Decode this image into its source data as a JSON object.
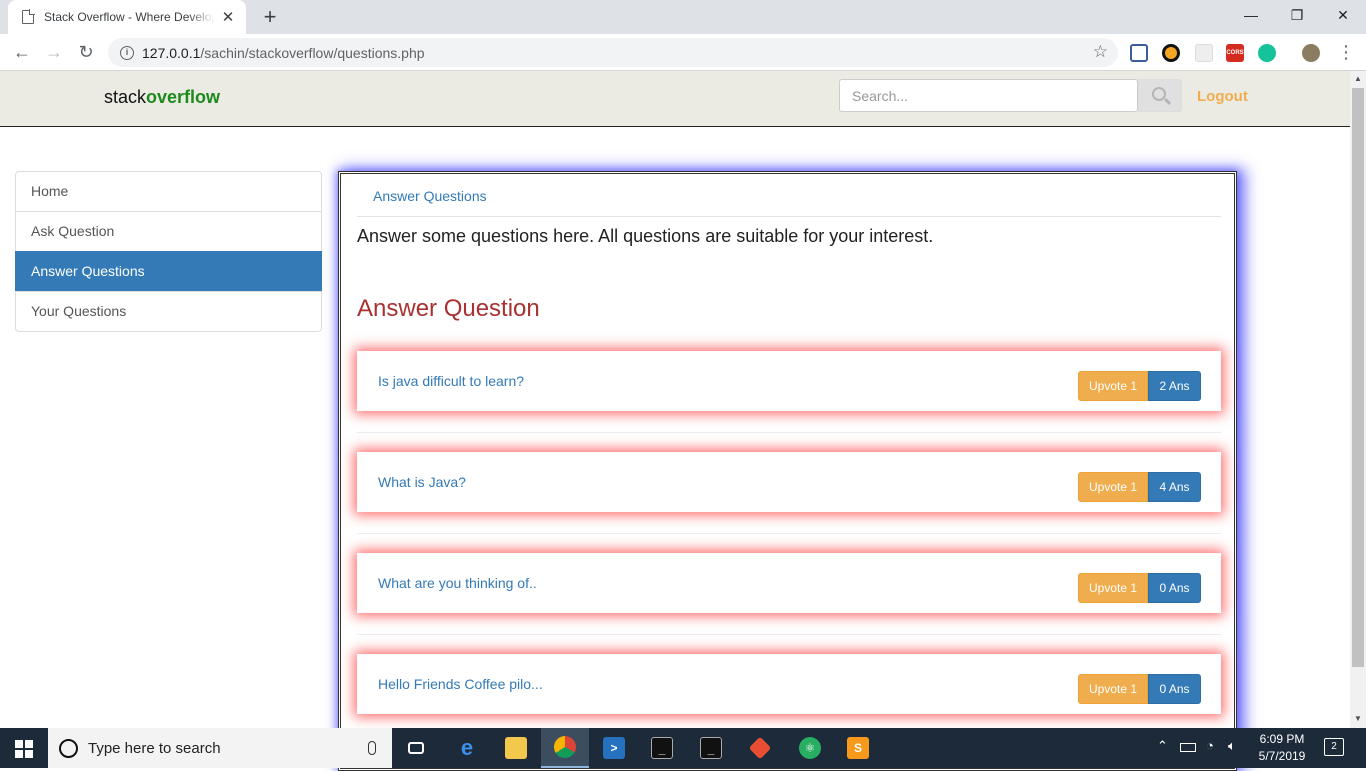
{
  "browser": {
    "tab_title": "Stack Overflow - Where Developers",
    "tab_close": "✕",
    "new_tab": "+",
    "url_host": "127.0.0.1",
    "url_path": "/sachin/stackoverflow/questions.php",
    "window_minimize": "—",
    "window_restore": "❐",
    "window_close": "✕"
  },
  "navbar": {
    "brand_plain": "stack",
    "brand_bold": "overflow",
    "search_placeholder": "Search...",
    "logout": "Logout"
  },
  "sidebar": {
    "items": [
      {
        "label": "Home"
      },
      {
        "label": "Ask Question"
      },
      {
        "label": "Answer Questions"
      },
      {
        "label": "Your Questions"
      }
    ]
  },
  "main": {
    "breadcrumb": "Answer Questions",
    "intro": "Answer some questions here. All questions are suitable for your interest.",
    "heading": "Answer Question",
    "questions": [
      {
        "title": "Is java difficult to learn?",
        "upvote": "Upvote 1",
        "answers": "2 Ans"
      },
      {
        "title": "What is Java?",
        "upvote": "Upvote 1",
        "answers": "4 Ans"
      },
      {
        "title": "What are you thinking of..",
        "upvote": "Upvote 1",
        "answers": "0 Ans"
      },
      {
        "title": "Hello Friends Coffee pilo...",
        "upvote": "Upvote 1",
        "answers": "0 Ans"
      }
    ]
  },
  "taskbar": {
    "search_label": "Type here to search",
    "time": "6:09 PM",
    "date": "5/7/2019",
    "notifications": "2"
  },
  "colors": {
    "brand_green": "#1d8a1d",
    "primary": "#337ab7",
    "warning": "#f0ad4e",
    "heading_red": "#a83232"
  }
}
